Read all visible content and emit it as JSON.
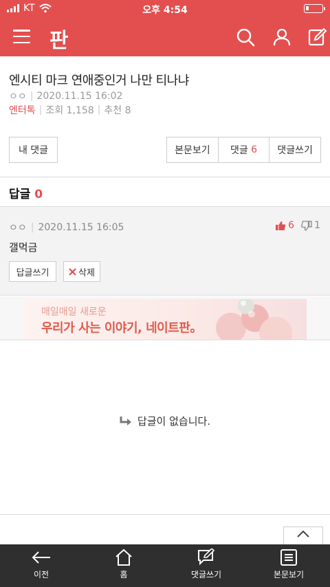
{
  "status_bar": {
    "carrier": "KT",
    "time": "오후 4:54",
    "battery_level": 0.2
  },
  "header": {
    "logo": "판"
  },
  "article": {
    "title": "엔시티 마크 연애중인거 나만 티나냐",
    "author": "ㅇㅇ",
    "date": "2020.11.15 16:02",
    "category": "엔터톡",
    "views": "조회 1,158",
    "recommends": "추천 8"
  },
  "buttons": {
    "my_comments": "내 댓글",
    "view_article": "본문보기",
    "comments_label": "댓글",
    "comments_count": "6",
    "write_comment": "댓글쓰기"
  },
  "replies": {
    "label": "답글",
    "count": "0"
  },
  "comment": {
    "author": "ㅇㅇ",
    "date": "2020.11.15 16:05",
    "likes": "6",
    "dislikes": "1",
    "text": "갤먹금",
    "reply_button": "답글쓰기",
    "delete_button": "삭제"
  },
  "banner": {
    "sub": "매일매일 새로운",
    "main": "우리가 사는 이야기, 네이트판。"
  },
  "empty_message": "답글이 없습니다.",
  "bottom_nav": [
    {
      "label": "이전",
      "icon": "arrow-left-icon"
    },
    {
      "label": "홈",
      "icon": "home-icon"
    },
    {
      "label": "댓글쓰기",
      "icon": "comment-write-icon"
    },
    {
      "label": "본문보기",
      "icon": "document-icon"
    }
  ],
  "colors": {
    "accent": "#e34f4f",
    "nav_bg": "#2f2f2f"
  }
}
